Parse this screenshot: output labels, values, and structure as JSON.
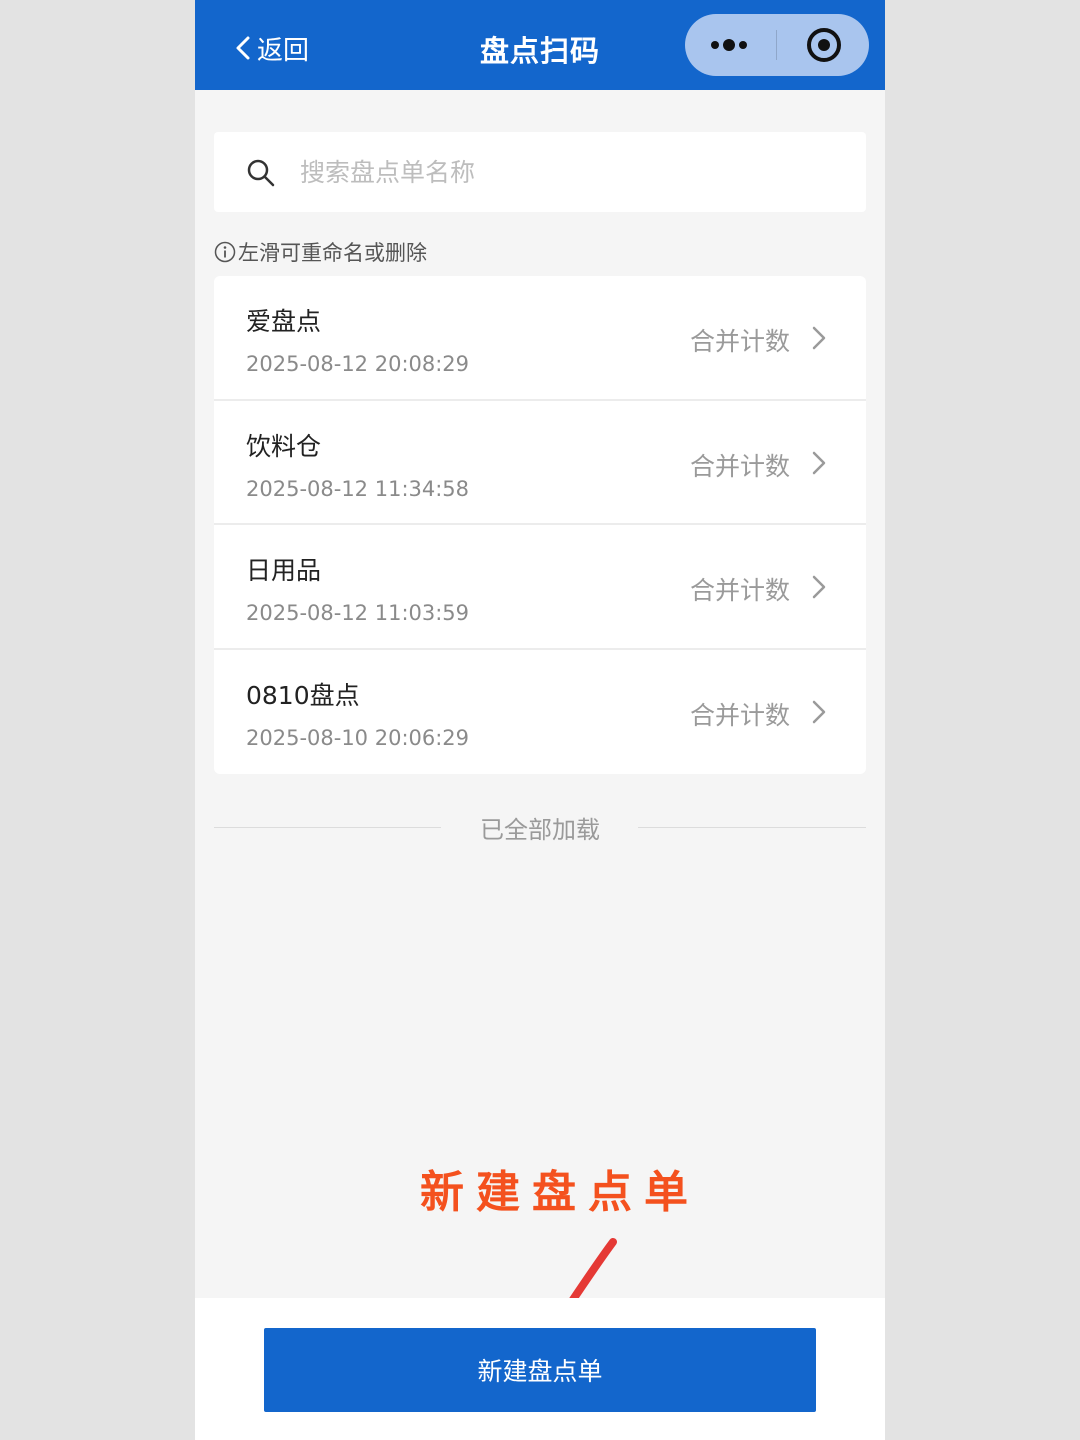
{
  "navbar": {
    "back_label": "返回",
    "title": "盘点扫码",
    "icons": {
      "back": "chevron-left-icon",
      "more": "more-dots-icon",
      "close": "target-circle-icon"
    }
  },
  "search": {
    "placeholder": "搜索盘点单名称",
    "value": ""
  },
  "hint": {
    "text": "左滑可重命名或删除",
    "icon": "info-icon"
  },
  "list": {
    "items": [
      {
        "name": "爱盘点",
        "time": "2025-08-12 20:08:29",
        "action": "合并计数"
      },
      {
        "name": "饮料仓",
        "time": "2025-08-12 11:34:58",
        "action": "合并计数"
      },
      {
        "name": "日用品",
        "time": "2025-08-12 11:03:59",
        "action": "合并计数"
      },
      {
        "name": "0810盘点",
        "time": "2025-08-10 20:06:29",
        "action": "合并计数"
      }
    ]
  },
  "status": {
    "loaded": "已全部加载"
  },
  "annotation": {
    "text": "新建盘点单",
    "color": "#f4511e"
  },
  "footer": {
    "new_button_label": "新建盘点单"
  },
  "colors": {
    "primary": "#1366cc",
    "capsule": "#a9c5ee",
    "annotation": "#f4511e"
  }
}
